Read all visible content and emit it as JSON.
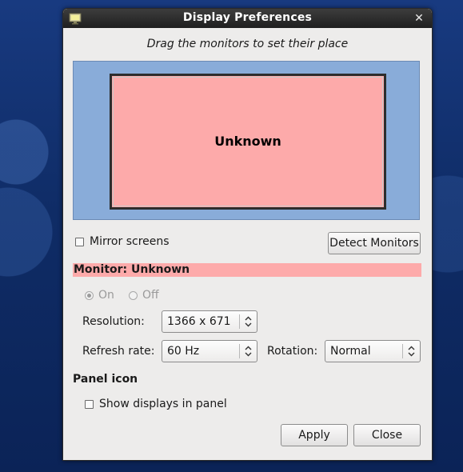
{
  "window": {
    "title": "Display Preferences",
    "close_icon": "close-icon",
    "app_icon": "display-icon"
  },
  "instruction": "Drag the monitors to set their place",
  "monitor_layout": {
    "monitor_name": "Unknown",
    "area_color": "#89acd9",
    "monitor_color": "#fdaaaa"
  },
  "mirror": {
    "label": "Mirror screens",
    "checked": false
  },
  "detect_button": "Detect Monitors",
  "monitor_section": {
    "header": "Monitor: Unknown",
    "power_on_label": "On",
    "power_off_label": "Off",
    "power_selected": "On",
    "resolution_label": "Resolution:",
    "resolution_value": "1366 x 671",
    "refresh_label": "Refresh rate:",
    "refresh_value": "60 Hz",
    "rotation_label": "Rotation:",
    "rotation_value": "Normal"
  },
  "panel_icon": {
    "title": "Panel icon",
    "show_label": "Show displays in panel",
    "checked": false
  },
  "buttons": {
    "apply": "Apply",
    "close": "Close"
  }
}
